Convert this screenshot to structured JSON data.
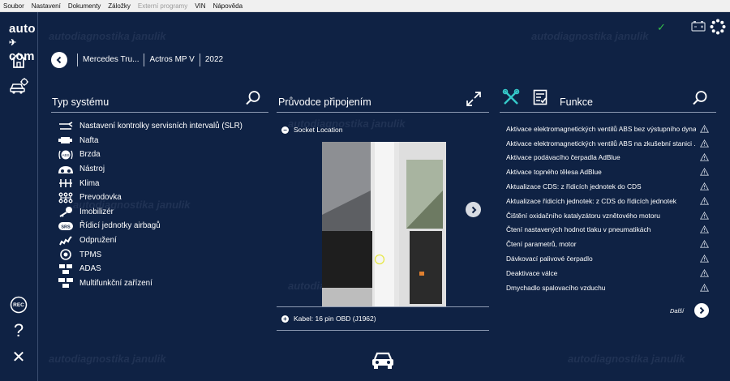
{
  "menu": [
    {
      "label": "Soubor",
      "enabled": true
    },
    {
      "label": "Nastavení",
      "enabled": true
    },
    {
      "label": "Dokumenty",
      "enabled": true
    },
    {
      "label": "Záložky",
      "enabled": true
    },
    {
      "label": "Externí programy",
      "enabled": false
    },
    {
      "label": "VIN",
      "enabled": true
    },
    {
      "label": "Nápověda",
      "enabled": true
    }
  ],
  "brand": {
    "left": "auto",
    "mid": "✈",
    "right": "com"
  },
  "breadcrumb": [
    "Mercedes Tru...",
    "Actros MP V",
    "2022"
  ],
  "system_panel": {
    "title": "Typ systému",
    "items": [
      {
        "label": "Nastavení kontrolky servisních intervalů (SLR)",
        "icon": "wrench-icon"
      },
      {
        "label": "Nafta",
        "icon": "engine-icon"
      },
      {
        "label": "Brzda",
        "icon": "brake-icon"
      },
      {
        "label": "Nástroj",
        "icon": "instrument-icon"
      },
      {
        "label": "Klima",
        "icon": "climate-icon"
      },
      {
        "label": "Prevodovka",
        "icon": "gearbox-icon"
      },
      {
        "label": "Imobilizér",
        "icon": "key-icon"
      },
      {
        "label": "Řídicí jednotky airbagů",
        "icon": "srs-icon"
      },
      {
        "label": "Odpružení",
        "icon": "suspension-icon"
      },
      {
        "label": "TPMS",
        "icon": "tpms-icon"
      },
      {
        "label": "ADAS",
        "icon": "adas-icon"
      },
      {
        "label": "Multifunkční zařízení",
        "icon": "multifunction-icon"
      }
    ]
  },
  "guide_panel": {
    "title": "Průvodce připojením",
    "socket_label": "Socket Location",
    "cable_label": "Kabel: 16 pin OBD (J1962)",
    "minus": "−",
    "plus": "+"
  },
  "function_panel": {
    "title": "Funkce",
    "items": [
      "Aktivace elektromagnetických ventilů ABS bez výstupního dyna...",
      "Aktivace elektromagnetických ventilů ABS na zkušební stanici ...",
      "Aktivace podávacího čerpadla AdBlue",
      "Aktivace topného tělesa AdBlue",
      "Aktualizace CDS: z řídicích jednotek do CDS",
      "Aktualizace řídicích jednotek: z CDS do řídicích jednotek",
      "Čištění oxidačního katalyzátoru vznětového motoru",
      "Čtení nastavených hodnot tlaku v pneumatikách",
      "Čtení parametrů, motor",
      "Dávkovací palivové čerpadlo",
      "Deaktivace válce",
      "Dmychadlo spalovacího vzduchu"
    ],
    "next_label": "Další"
  },
  "status": {
    "connection": "✓"
  },
  "sidebar_labels": {
    "rec": "REC",
    "help": "?",
    "close": "✕"
  },
  "watermark": "autodiagnostika janulik",
  "colors": {
    "background": "#0f2244",
    "accent_ok": "#35c04a",
    "text": "#ffffff",
    "divider": "#8e9bb3"
  }
}
